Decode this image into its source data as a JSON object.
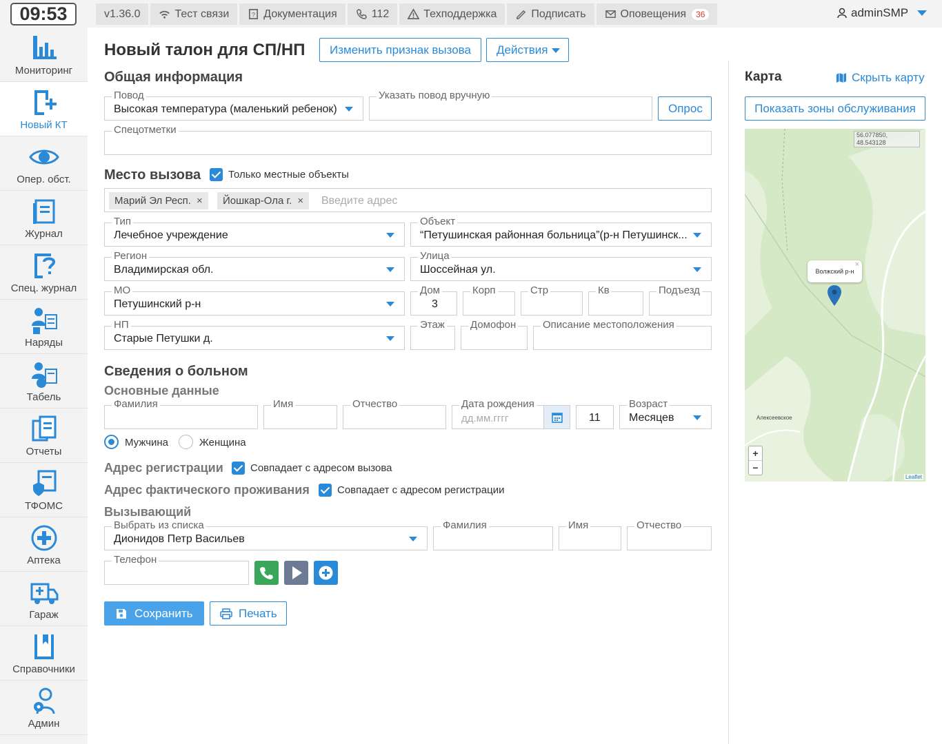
{
  "clock": "09:53",
  "topbar": {
    "version": "v1.36.0",
    "test": "Тест связи",
    "docs": "Документация",
    "phone": "112",
    "support": "Техподдержка",
    "sign": "Подписать",
    "alerts": "Оповещения",
    "alerts_count": "36",
    "user": "adminSMP"
  },
  "sidebar": {
    "items": [
      {
        "label": "Мониторинг",
        "icon": "chart-icon"
      },
      {
        "label": "Новый КТ",
        "icon": "new-document-icon"
      },
      {
        "label": "Опер. обст.",
        "icon": "eye-icon"
      },
      {
        "label": "Журнал",
        "icon": "journal-icon"
      },
      {
        "label": "Спец. журнал",
        "icon": "question-document-icon"
      },
      {
        "label": "Наряды",
        "icon": "team-icon"
      },
      {
        "label": "Табель",
        "icon": "timesheet-icon"
      },
      {
        "label": "Отчеты",
        "icon": "reports-icon"
      },
      {
        "label": "ТФОМС",
        "icon": "shield-document-icon"
      },
      {
        "label": "Аптека",
        "icon": "pharmacy-icon"
      },
      {
        "label": "Гараж",
        "icon": "ambulance-icon"
      },
      {
        "label": "Справочники",
        "icon": "book-icon"
      },
      {
        "label": "Админ",
        "icon": "admin-icon"
      }
    ]
  },
  "header": {
    "title": "Новый талон для СП/НП",
    "change_btn": "Изменить признак вызова",
    "actions_btn": "Действия"
  },
  "general": {
    "title": "Общая информация",
    "reason_label": "Повод",
    "reason_value": "Высокая температура (маленький ребенок)",
    "manual_label": "Указать повод вручную",
    "survey_btn": "Опрос",
    "marks_label": "Спецотметки"
  },
  "place": {
    "title": "Место вызова",
    "local_only": "Только местные объекты",
    "tags": [
      "Марий Эл Респ.",
      "Йошкар-Ола г."
    ],
    "addr_placeholder": "Введите адрес",
    "type_label": "Тип",
    "type_value": "Лечебное учреждение",
    "object_label": "Объект",
    "object_value": "“Петушинская районная больница”(р-н Петушинск...",
    "region_label": "Регион",
    "region_value": "Владимирская обл.",
    "street_label": "Улица",
    "street_value": "Шоссейная ул.",
    "mo_label": "МО",
    "mo_value": "Петушинский р-н",
    "house_label": "Дом",
    "house_value": "3",
    "korp_label": "Корп",
    "str_label": "Стр",
    "kv_label": "Кв",
    "entrance_label": "Подъезд",
    "np_label": "НП",
    "np_value": "Старые Петушки д.",
    "floor_label": "Этаж",
    "intercom_label": "Домофон",
    "desc_label": "Описание местоположения"
  },
  "patient": {
    "title": "Сведения о больном",
    "basic": "Основные данные",
    "surname_label": "Фамилия",
    "name_label": "Имя",
    "patronymic_label": "Отчество",
    "dob_label": "Дата рождения",
    "dob_placeholder": "дд.мм.гггг",
    "age_value": "11",
    "age_label": "Возраст",
    "age_unit": "Месяцев",
    "male": "Мужчина",
    "female": "Женщина",
    "reg_addr": "Адрес регистрации",
    "reg_same": "Совпадает с адресом вызова",
    "fact_addr": "Адрес фактического проживания",
    "fact_same": "Совпадает с адресом регистрации"
  },
  "caller": {
    "title": "Вызывающий",
    "select_label": "Выбрать из списка",
    "select_value": "Дионидов Петр Васильев",
    "surname_label": "Фамилия",
    "name_label": "Имя",
    "patronymic_label": "Отчество",
    "phone_label": "Телефон"
  },
  "footer": {
    "save": "Сохранить",
    "print": "Печать"
  },
  "map": {
    "title": "Карта",
    "hide": "Скрыть карту",
    "zones_btn": "Показать зоны обслуживания",
    "coords": "56.077850, 48.543128",
    "popup": "Волжский р-н",
    "place1": "Алексеевское",
    "zoom_in": "+",
    "zoom_out": "−",
    "attribution": "Leaflet"
  },
  "colors": {
    "accent": "#2a8ad8",
    "call_green": "#3aa65a",
    "play_gray": "#6d7a94"
  }
}
